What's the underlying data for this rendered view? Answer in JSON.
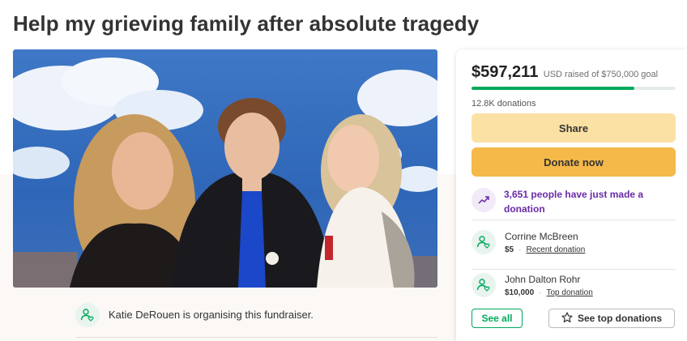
{
  "page": {
    "title": "Help my grieving family after absolute tragedy"
  },
  "organiser": {
    "text": "Katie DeRouen is organising this fundraiser."
  },
  "donation_card": {
    "raised_amount": "$597,211",
    "raised_goal_text": "USD raised of $750,000 goal",
    "progress_fraction": 0.796,
    "donations_count": "12.8K donations",
    "share_label": "Share",
    "donate_label": "Donate now",
    "trend_text": "3,651 people have just made a donation",
    "donors": [
      {
        "name": "Corrine McBreen",
        "amount": "$5",
        "tag": "Recent donation"
      },
      {
        "name": "John Dalton Rohr",
        "amount": "$10,000",
        "tag": "Top donation"
      }
    ],
    "see_all_label": "See all",
    "see_top_label": "See top donations"
  },
  "colors": {
    "brand_green": "#02a95c",
    "trend_purple": "#6a2aa6",
    "share_bg": "#fbe1a3",
    "donate_bg": "#f5b94a"
  },
  "icons": {
    "organiser": "person-heart-icon",
    "trend": "trending-up-icon",
    "donor": "person-heart-icon",
    "see_top": "star-icon"
  }
}
